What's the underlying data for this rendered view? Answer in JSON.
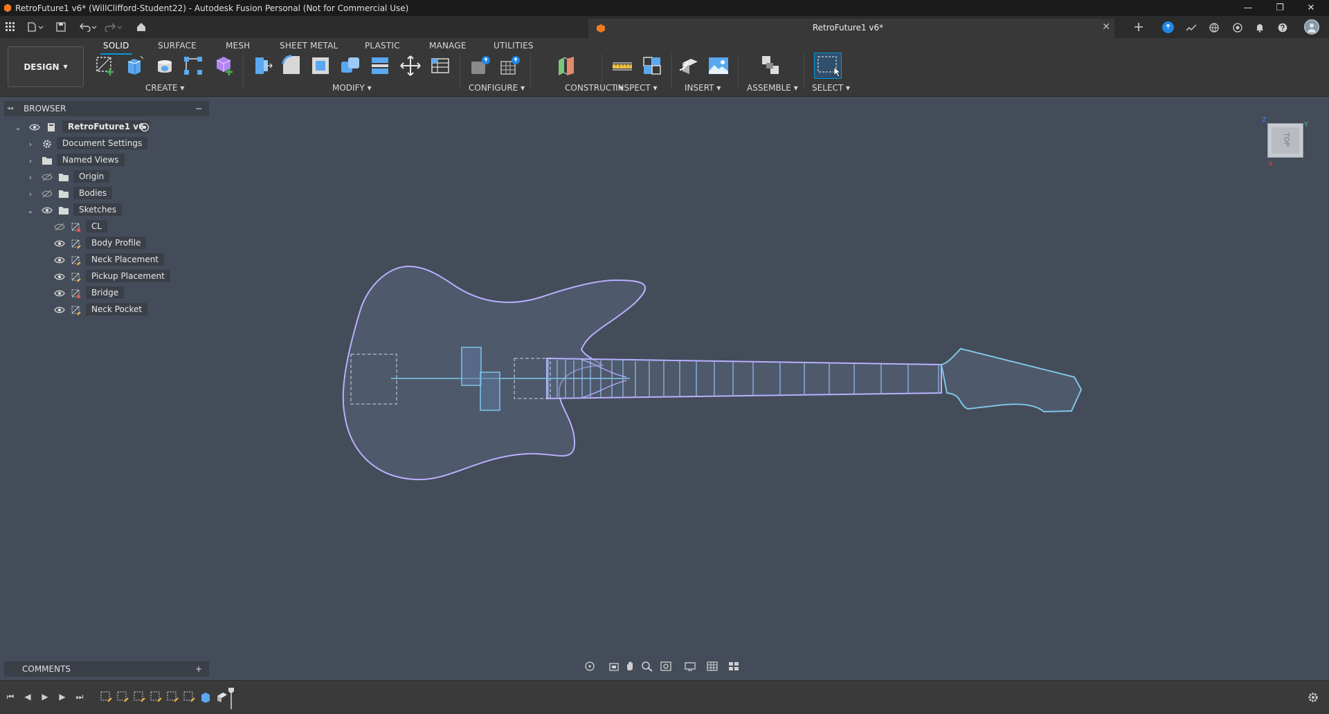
{
  "window": {
    "title": "RetroFuture1 v6* (WillClifford-Student22) - Autodesk Fusion Personal (Not for Commercial Use)",
    "minimize": "—",
    "maximize": "❐",
    "close": "✕"
  },
  "document_tab": {
    "title": "RetroFuture1 v6*",
    "close": "✕"
  },
  "toolbar": {
    "workspace": "DESIGN",
    "tabs": [
      "SOLID",
      "SURFACE",
      "MESH",
      "SHEET METAL",
      "PLASTIC",
      "MANAGE",
      "UTILITIES"
    ],
    "groups": {
      "create": "CREATE",
      "modify": "MODIFY",
      "configure": "CONFIGURE",
      "construct": "CONSTRUCT",
      "inspect": "INSPECT",
      "insert": "INSERT",
      "assemble": "ASSEMBLE",
      "select": "SELECT"
    }
  },
  "browser": {
    "title": "BROWSER",
    "collapse": "−",
    "root": "RetroFuture1 v6",
    "items": [
      "Document Settings",
      "Named Views",
      "Origin",
      "Bodies",
      "Sketches"
    ],
    "sketches": [
      "CL",
      "Body Profile",
      "Neck Placement",
      "Pickup Placement",
      "Bridge",
      "Neck Pocket"
    ]
  },
  "comments": {
    "title": "COMMENTS",
    "add": "+"
  },
  "viewcube": {
    "face": "TOP",
    "axis_z": "Z",
    "axis_y": "Y",
    "axis_x": "X"
  },
  "colors": {
    "accent": "#0696d7",
    "canvas": "#454c59",
    "sketch_line": "#a9b4ff",
    "sketch_fill": "#56647c"
  }
}
